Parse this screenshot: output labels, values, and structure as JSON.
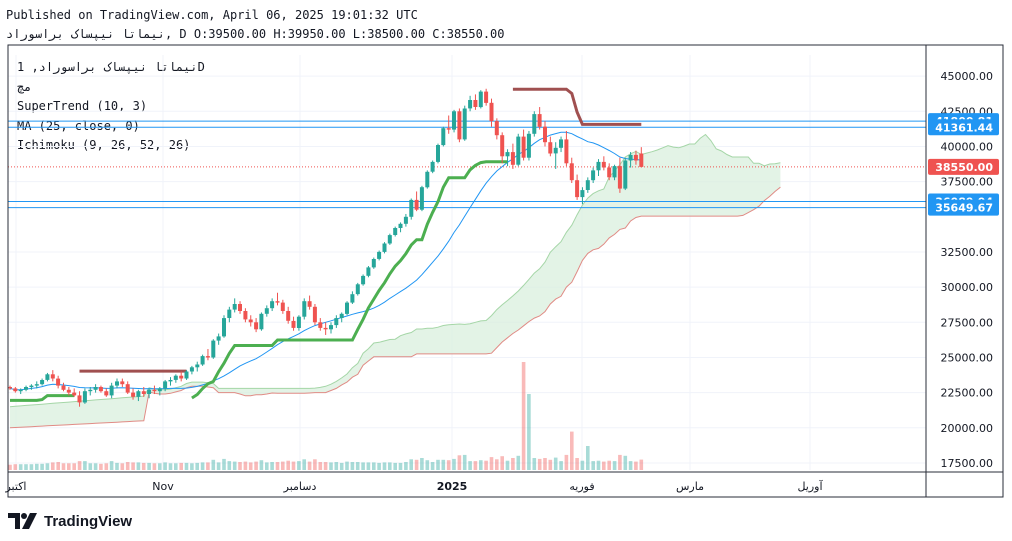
{
  "header": {
    "published_line": "Published on TradingView.com, April 06, 2025 19:01:32 UTC",
    "ohlc_line": "نيماتا نيپساک براسوراد, D O:39500.00 H:39950.00 L:38500.00 C:38550.00"
  },
  "legend": {
    "symbol": "نيماتا نيپساک براسوراد, 1D",
    "exchange": "مچ",
    "indicators": [
      "SuperTrend (10, 3)",
      "MA (25, close, 0)",
      "Ichimoku (9, 26, 52, 26)"
    ]
  },
  "brand": {
    "name": "TradingView"
  },
  "colors": {
    "up": "#26a69a",
    "down": "#ef5350",
    "supertrend_up": "#4caf50",
    "supertrend_down": "#a05050",
    "ma": "#2196f3",
    "cloud": "#d7eedb",
    "lagging_lower": "#e08b85",
    "hline": "#2962ff"
  },
  "chart_data": {
    "type": "candlestick",
    "y_axis": {
      "ticks": [
        "45000.00",
        "42500.00",
        "40000.00",
        "37500.00",
        "32500.00",
        "30000.00",
        "27500.00",
        "25000.00",
        "22500.00",
        "20000.00",
        "17500.00"
      ],
      "range": [
        17000,
        46500
      ]
    },
    "x_axis": {
      "ticks": [
        "اکتبر",
        "Nov",
        "دسامبر",
        "2025",
        "فوريه",
        "مارس",
        "آوريل"
      ]
    },
    "price_tags": [
      {
        "label": "41800.81",
        "value": 41800.81,
        "color": "#2196f3"
      },
      {
        "label": "41361.44",
        "value": 41361.44,
        "color": "#2196f3"
      },
      {
        "label": "38550.00",
        "value": 38550,
        "color": "#ef5350"
      },
      {
        "label": "36089.04",
        "value": 36089.04,
        "color": "#2196f3"
      },
      {
        "label": "35649.67",
        "value": 35649.67,
        "color": "#2196f3"
      }
    ],
    "horizontal_lines": [
      41800.81,
      41361.44,
      36089.04,
      35649.67
    ],
    "last_close": 38550,
    "candles": [
      [
        22900,
        23000,
        22700,
        22800
      ],
      [
        22800,
        22900,
        22500,
        22600
      ],
      [
        22600,
        22800,
        22400,
        22700
      ],
      [
        22700,
        23000,
        22600,
        22900
      ],
      [
        22900,
        23100,
        22700,
        23000
      ],
      [
        23000,
        23300,
        22800,
        23100
      ],
      [
        23100,
        23500,
        23000,
        23400
      ],
      [
        23400,
        23900,
        23300,
        23800
      ],
      [
        23800,
        24100,
        23300,
        23500
      ],
      [
        23500,
        23700,
        22800,
        23000
      ],
      [
        23000,
        23200,
        22600,
        22700
      ],
      [
        22700,
        22900,
        22300,
        22500
      ],
      [
        22500,
        22800,
        22200,
        22300
      ],
      [
        22300,
        22600,
        21500,
        21800
      ],
      [
        21800,
        22800,
        21700,
        22600
      ],
      [
        22600,
        22900,
        22300,
        22700
      ],
      [
        22700,
        23100,
        22500,
        22900
      ],
      [
        22900,
        23000,
        22500,
        22600
      ],
      [
        22600,
        22800,
        22200,
        22300
      ],
      [
        22300,
        23200,
        22100,
        23000
      ],
      [
        23000,
        23500,
        22800,
        23300
      ],
      [
        23300,
        23500,
        22900,
        23100
      ],
      [
        23100,
        23300,
        22400,
        22500
      ],
      [
        22500,
        22800,
        22000,
        22200
      ],
      [
        22200,
        22700,
        21900,
        22600
      ],
      [
        22600,
        22900,
        22200,
        22400
      ],
      [
        22400,
        22800,
        22100,
        22700
      ],
      [
        22700,
        23000,
        22400,
        22600
      ],
      [
        22600,
        22900,
        22300,
        22800
      ],
      [
        22800,
        23400,
        22600,
        23300
      ],
      [
        23300,
        23600,
        23000,
        23400
      ],
      [
        23400,
        23800,
        23200,
        23700
      ],
      [
        23700,
        24000,
        23300,
        23500
      ],
      [
        23500,
        24100,
        23400,
        24000
      ],
      [
        24000,
        24400,
        23800,
        24300
      ],
      [
        24300,
        24700,
        24000,
        24500
      ],
      [
        24500,
        25200,
        24400,
        25100
      ],
      [
        25100,
        25600,
        24800,
        25000
      ],
      [
        25000,
        26300,
        24900,
        26200
      ],
      [
        26200,
        26700,
        25900,
        26500
      ],
      [
        26500,
        28000,
        26400,
        27800
      ],
      [
        27800,
        28600,
        27500,
        28400
      ],
      [
        28400,
        29200,
        28200,
        28800
      ],
      [
        28800,
        29000,
        28100,
        28300
      ],
      [
        28300,
        28500,
        27500,
        27700
      ],
      [
        27700,
        28000,
        27200,
        27500
      ],
      [
        27500,
        27800,
        26800,
        27000
      ],
      [
        27000,
        28200,
        26900,
        28100
      ],
      [
        28100,
        28700,
        27900,
        28500
      ],
      [
        28500,
        29200,
        28300,
        29000
      ],
      [
        29000,
        29600,
        28700,
        28900
      ],
      [
        28900,
        29100,
        28100,
        28300
      ],
      [
        28300,
        28600,
        27400,
        27600
      ],
      [
        27600,
        27900,
        26900,
        27100
      ],
      [
        27100,
        28000,
        26900,
        27900
      ],
      [
        27900,
        29200,
        27700,
        29000
      ],
      [
        29000,
        29400,
        28400,
        28600
      ],
      [
        28600,
        28800,
        27300,
        27500
      ],
      [
        27500,
        27800,
        26900,
        27100
      ],
      [
        27100,
        27500,
        26600,
        27000
      ],
      [
        27000,
        27500,
        26700,
        27300
      ],
      [
        27300,
        28000,
        27100,
        27800
      ],
      [
        27800,
        28200,
        27500,
        28100
      ],
      [
        28100,
        29000,
        28000,
        28900
      ],
      [
        28900,
        29700,
        28800,
        29500
      ],
      [
        29500,
        30300,
        29400,
        30200
      ],
      [
        30200,
        30900,
        30100,
        30800
      ],
      [
        30800,
        31500,
        30700,
        31400
      ],
      [
        31400,
        32100,
        31300,
        32000
      ],
      [
        32000,
        32600,
        31900,
        32500
      ],
      [
        32500,
        33200,
        32400,
        33100
      ],
      [
        33100,
        33800,
        33000,
        33700
      ],
      [
        33700,
        34300,
        33600,
        34200
      ],
      [
        34200,
        34600,
        33900,
        34500
      ],
      [
        34500,
        35200,
        34300,
        35000
      ],
      [
        35000,
        36300,
        34800,
        36200
      ],
      [
        36200,
        36800,
        35400,
        35500
      ],
      [
        35500,
        37200,
        35400,
        37100
      ],
      [
        37100,
        38300,
        37000,
        38200
      ],
      [
        38200,
        39000,
        38100,
        38900
      ],
      [
        38900,
        40200,
        38800,
        40100
      ],
      [
        40100,
        41400,
        40000,
        41300
      ],
      [
        41300,
        42200,
        40900,
        41200
      ],
      [
        41200,
        42600,
        41000,
        42500
      ],
      [
        42500,
        42700,
        40300,
        40500
      ],
      [
        40500,
        42900,
        40400,
        42700
      ],
      [
        42700,
        43600,
        42500,
        43300
      ],
      [
        43300,
        43700,
        42600,
        42800
      ],
      [
        42800,
        44000,
        42700,
        43900
      ],
      [
        43900,
        44100,
        42900,
        43100
      ],
      [
        43100,
        43400,
        41400,
        41800
      ],
      [
        41800,
        42000,
        40500,
        40800
      ],
      [
        40800,
        41000,
        38800,
        39300
      ],
      [
        39300,
        39800,
        38600,
        39600
      ],
      [
        39600,
        40200,
        38400,
        38700
      ],
      [
        38700,
        40900,
        38600,
        40700
      ],
      [
        40700,
        41200,
        39000,
        39200
      ],
      [
        39200,
        41100,
        39000,
        40900
      ],
      [
        40900,
        42500,
        40700,
        42300
      ],
      [
        42300,
        42800,
        41200,
        41400
      ],
      [
        41400,
        41800,
        40000,
        40300
      ],
      [
        40300,
        40700,
        39300,
        39500
      ],
      [
        39500,
        40300,
        38400,
        39900
      ],
      [
        39900,
        40700,
        39600,
        40500
      ],
      [
        40500,
        41100,
        38600,
        38800
      ],
      [
        38800,
        39200,
        37400,
        37600
      ],
      [
        37600,
        38000,
        36200,
        36400
      ],
      [
        36400,
        37100,
        35900,
        36900
      ],
      [
        36900,
        37800,
        36700,
        37600
      ],
      [
        37600,
        38500,
        37400,
        38300
      ],
      [
        38300,
        39100,
        37900,
        38900
      ],
      [
        38900,
        39300,
        38300,
        38500
      ],
      [
        38500,
        38800,
        37600,
        37800
      ],
      [
        37800,
        38700,
        37600,
        38600
      ],
      [
        38600,
        39200,
        36700,
        37000
      ],
      [
        37000,
        39200,
        36900,
        39000
      ],
      [
        39000,
        39600,
        38500,
        39400
      ],
      [
        39400,
        39700,
        38700,
        39000
      ],
      [
        39500,
        39950,
        38500,
        38550
      ]
    ]
  }
}
